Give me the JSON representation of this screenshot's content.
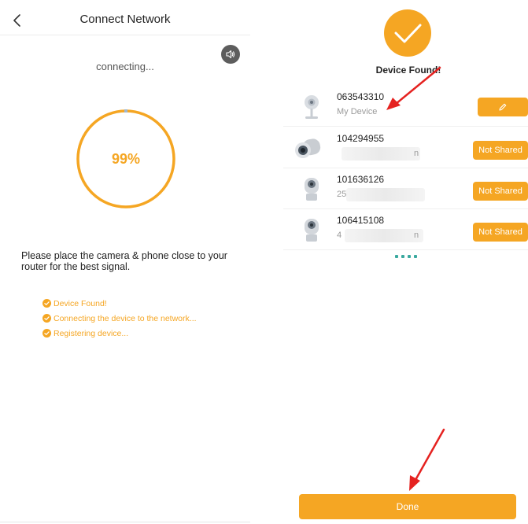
{
  "left": {
    "title": "Connect Network",
    "status": "connecting...",
    "progress": {
      "value": 99,
      "label": "99%"
    },
    "hint": "Please place the camera & phone close to your router for the best signal.",
    "steps": [
      {
        "label": "Device Found!"
      },
      {
        "label": "Connecting the device to the network..."
      },
      {
        "label": "Registering device..."
      }
    ]
  },
  "right": {
    "title": "Device Found!",
    "devices": [
      {
        "id": "063543310",
        "subtitle": "My Device",
        "action": "edit"
      },
      {
        "id": "104294955",
        "subtitle_fragment": "n",
        "action": "Not Shared"
      },
      {
        "id": "101636126",
        "subtitle_fragment": "25",
        "action": "Not Shared"
      },
      {
        "id": "106415108",
        "subtitle_fragment": "4",
        "subtitle_fragment_end": "n",
        "action": "Not Shared"
      }
    ],
    "done_label": "Done"
  },
  "colors": {
    "accent": "#f5a623",
    "annotation_arrow": "#e52220",
    "dots": "#3aa99f"
  }
}
